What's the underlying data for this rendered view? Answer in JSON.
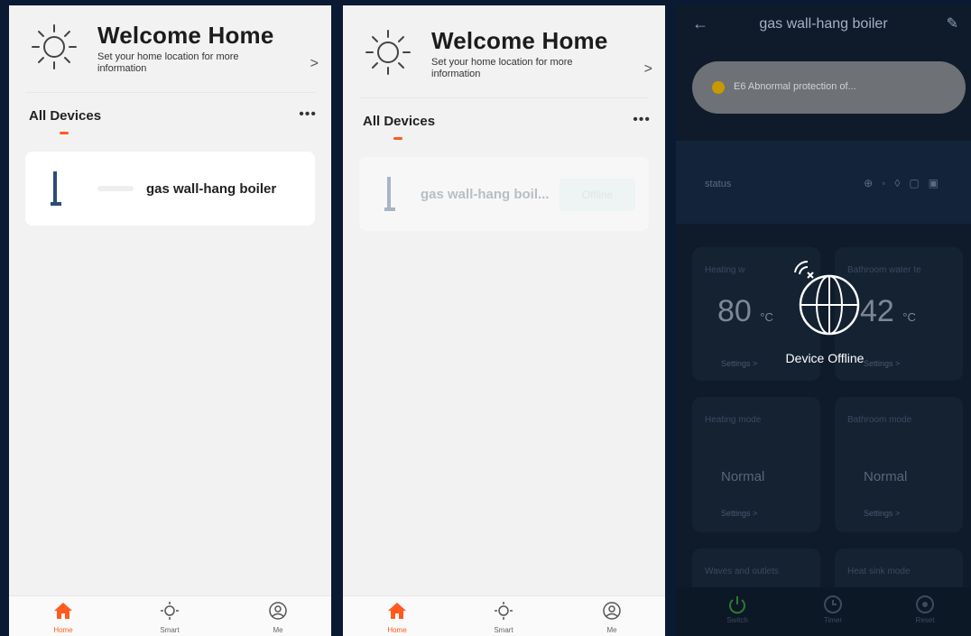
{
  "screen1": {
    "title": "Welcome Home",
    "subtitle": "Set your home location for more information",
    "chevron": ">",
    "tab_label": "All Devices",
    "more": "•••",
    "device_name": "gas wall-hang boiler",
    "tabbar": {
      "home": "Home",
      "smart": "Smart",
      "me": "Me"
    }
  },
  "screen2": {
    "title": "Welcome Home",
    "subtitle": "Set your home location for more information",
    "chevron": ">",
    "tab_label": "All Devices",
    "more": "•••",
    "device_name": "gas wall-hang boil...",
    "offline_label": "Offline",
    "tabbar": {
      "home": "Home",
      "smart": "Smart",
      "me": "Me"
    }
  },
  "screen3": {
    "title": "gas wall-hang boiler",
    "alert": "E6 Abnormal protection of...",
    "status_label": "status",
    "offline_text": "Device Offline",
    "tile_heating_temp": {
      "label": "Heating w",
      "value": "80",
      "unit": "°C",
      "settings": "Settings >"
    },
    "tile_bathroom_temp": {
      "label": "Bathroom water te",
      "value": "42",
      "unit": "°C",
      "settings": "Settings >"
    },
    "tile_heating_mode": {
      "label": "Heating mode",
      "value": "Normal",
      "settings": "Settings >"
    },
    "tile_bathroom_mode": {
      "label": "Bathroom mode",
      "value": "Normal",
      "settings": "Settings >"
    },
    "tile_extra1": {
      "label": "Waves and outlets"
    },
    "tile_extra2": {
      "label": "Heat sink mode"
    },
    "bottom": {
      "switch": "Switch",
      "timer": "Timer",
      "reset": "Reset"
    }
  },
  "colors": {
    "accent": "#ff5a1f",
    "dark_bg": "#0f1b2b",
    "light_bg": "#f2f2f2"
  }
}
